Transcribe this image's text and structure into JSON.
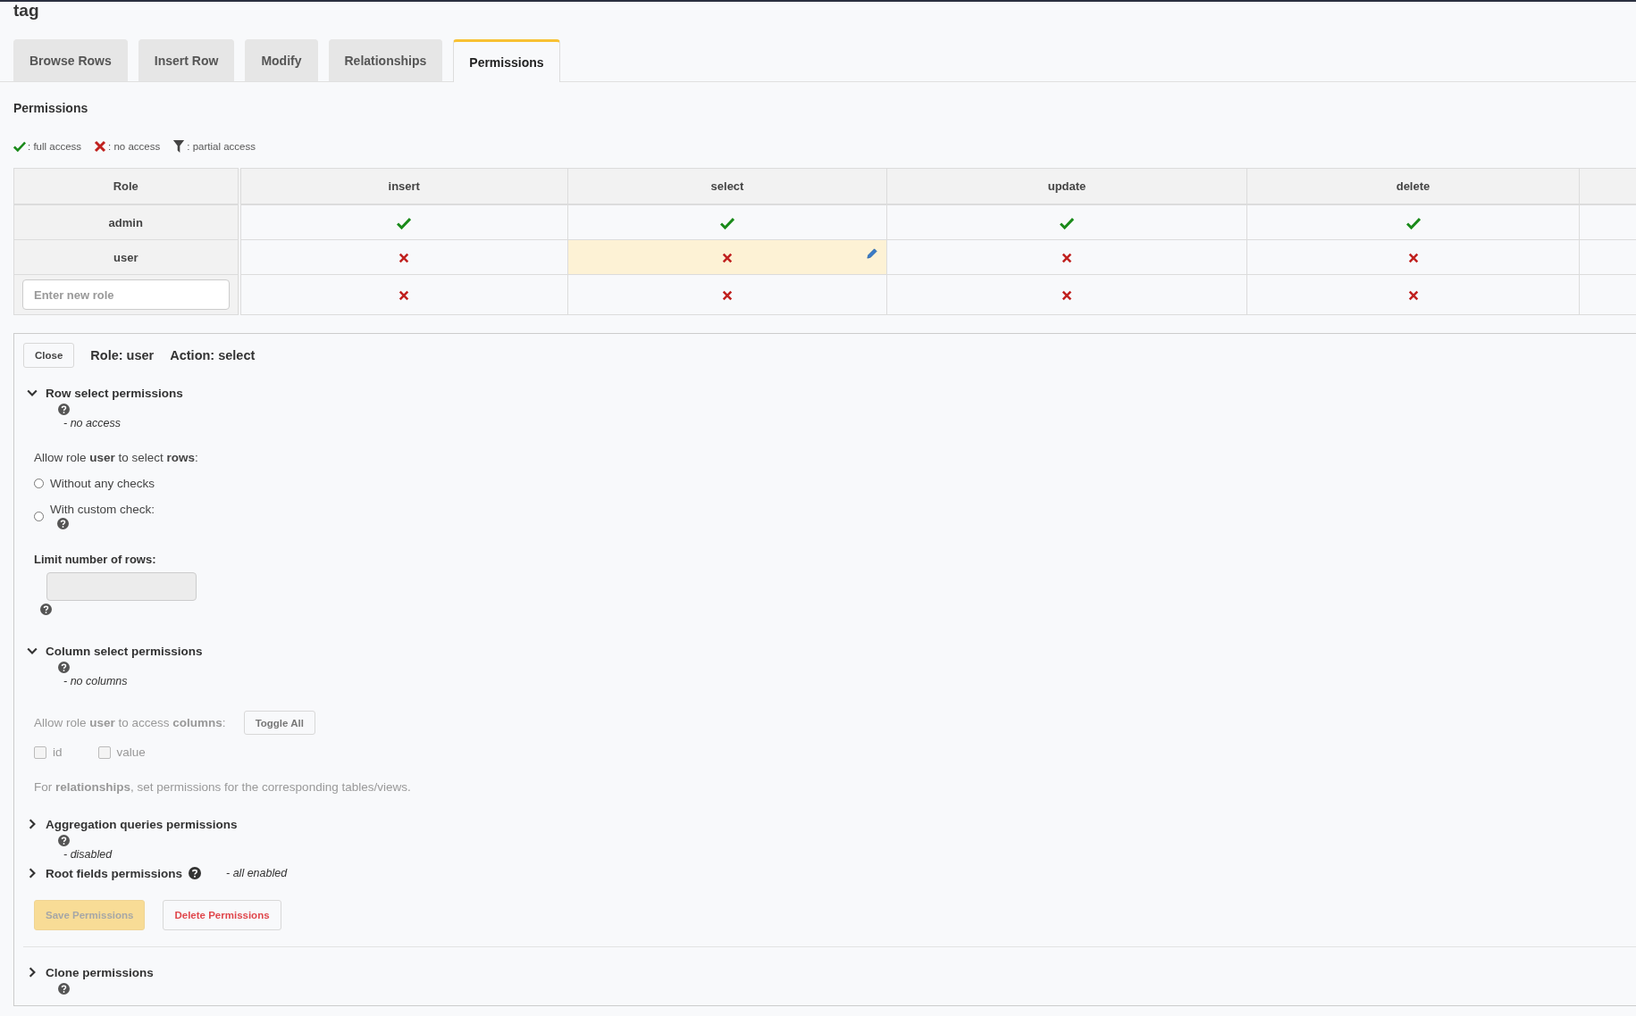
{
  "title": "tag",
  "tabs": [
    {
      "label": "Browse Rows",
      "selected": false
    },
    {
      "label": "Insert Row",
      "selected": false
    },
    {
      "label": "Modify",
      "selected": false
    },
    {
      "label": "Relationships",
      "selected": false
    },
    {
      "label": "Permissions",
      "selected": true
    }
  ],
  "heading": "Permissions",
  "legend": [
    {
      "kind": "full",
      "label": ": full access"
    },
    {
      "kind": "none",
      "label": ": no access"
    },
    {
      "kind": "partial",
      "label": ": partial access"
    }
  ],
  "table": {
    "columns": [
      "Role",
      "insert",
      "select",
      "update",
      "delete"
    ],
    "rows": [
      {
        "role": "admin",
        "cells": [
          {
            "kind": "full",
            "selected": false
          },
          {
            "kind": "full",
            "selected": false
          },
          {
            "kind": "full",
            "selected": false
          },
          {
            "kind": "full",
            "selected": false
          }
        ]
      },
      {
        "role": "user",
        "cells": [
          {
            "kind": "none",
            "selected": false
          },
          {
            "kind": "none",
            "selected": true
          },
          {
            "kind": "none",
            "selected": false
          },
          {
            "kind": "none",
            "selected": false
          }
        ]
      }
    ],
    "new_role": {
      "placeholder": "Enter new role",
      "cells": [
        {
          "kind": "none",
          "selected": false
        },
        {
          "kind": "none",
          "selected": false
        },
        {
          "kind": "none",
          "selected": false
        },
        {
          "kind": "none",
          "selected": false
        }
      ]
    }
  },
  "editor": {
    "close": "Close",
    "role": "Role: user",
    "action": "Action: select",
    "row_section": {
      "title": "Row select permissions",
      "expanded": true,
      "status": "- no access",
      "prompt": "Allow role **user** to select **rows**:",
      "options": [
        {
          "label": "Without any checks",
          "selected": false,
          "help": false
        },
        {
          "label": "With custom check:",
          "selected": false,
          "help": true
        }
      ],
      "limit_label": "Limit number of rows:",
      "limit_disabled": true
    },
    "column_section": {
      "title": "Column select permissions",
      "expanded": true,
      "status": "- no columns",
      "disabled": true,
      "prompt": "Allow role **user** to access **columns**:",
      "toggle": "Toggle All",
      "columns": [
        {
          "label": "id",
          "checked": false
        },
        {
          "label": "value",
          "checked": false
        }
      ],
      "note": "For **relationships**, set permissions for the corresponding tables/views."
    },
    "aggregation_section": {
      "title": "Aggregation queries permissions",
      "expanded": false,
      "status": "- disabled"
    },
    "root_section": {
      "title": "Root fields permissions",
      "expanded": false,
      "status": "- all enabled"
    },
    "save": {
      "label": "Save Permissions",
      "disabled": true
    },
    "delete": {
      "label": "Delete Permissions"
    },
    "clone_section": {
      "title": "Clone permissions",
      "expanded": false
    }
  }
}
